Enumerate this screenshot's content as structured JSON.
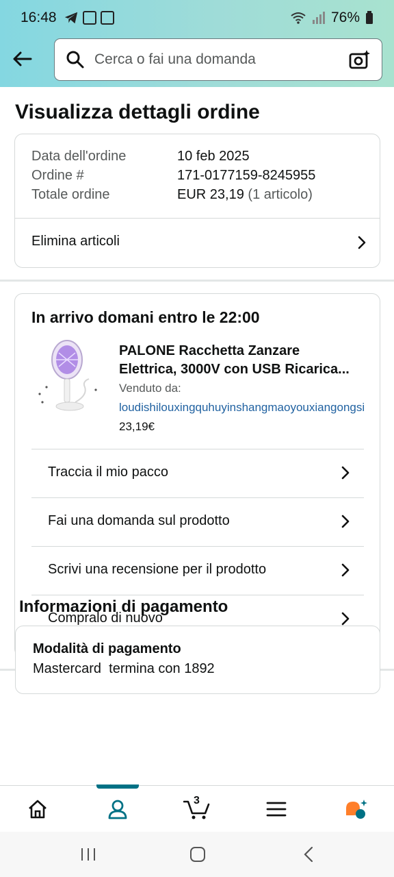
{
  "status_bar": {
    "time": "16:48",
    "battery": "76%"
  },
  "search": {
    "placeholder": "Cerca o fai una domanda"
  },
  "page": {
    "title": "Visualizza dettagli ordine"
  },
  "order_summary": {
    "rows": [
      {
        "label": "Data dell'ordine",
        "value": "10 feb 2025"
      },
      {
        "label": "Ordine #",
        "value": "171-0177159-8245955"
      },
      {
        "label": "Totale ordine",
        "value": "EUR 23,19",
        "extra": "(1 articolo)"
      }
    ],
    "delete_items_label": "Elimina articoli"
  },
  "shipment": {
    "delivery_text": "In arrivo domani entro le 22:00",
    "product": {
      "title_line1": "PALONE Racchetta Zanzare",
      "title_line2": "Elettrica, 3000V con USB Ricarica...",
      "sold_by_label": "Venduto da:",
      "seller": "loudishilouxingquhuyinshangmaoyouxiangongsi",
      "price": "23,19€",
      "image_icon": "mosquito-racket-image"
    },
    "actions": [
      {
        "label": "Traccia il mio pacco"
      },
      {
        "label": "Fai una domanda sul prodotto"
      },
      {
        "label": "Scrivi una recensione per il prodotto"
      },
      {
        "label": "Compralo di nuovo"
      }
    ]
  },
  "payment": {
    "section_title": "Informazioni di pagamento",
    "method_label": "Modalità di pagamento",
    "method_value": "Mastercard  termina con 1892"
  },
  "bottom_nav": {
    "items": [
      "home-icon",
      "account-icon",
      "cart-icon",
      "menu-icon",
      "rufus-icon"
    ],
    "active": "account-icon",
    "cart_count": "3"
  },
  "colors": {
    "accent": "#007185",
    "link": "#2162a1",
    "header_gradient_start": "#84d7e1",
    "header_gradient_end": "#a8e2cf",
    "rufus": "#ff7f2a"
  }
}
